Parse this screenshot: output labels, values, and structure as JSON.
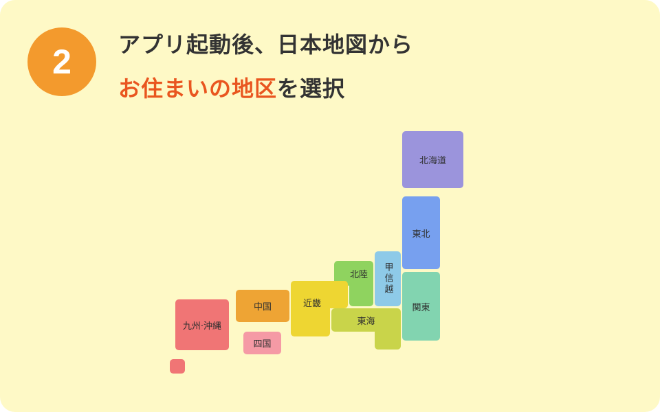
{
  "step": {
    "number": "2"
  },
  "title": {
    "line1": "アプリ起動後、日本地図から",
    "line2_highlight": "お住まいの地区",
    "line2_rest": "を選択"
  },
  "colors": {
    "card_bg": "#fef9c6",
    "badge": "#f39a2d",
    "highlight": "#e9561f",
    "text": "#333333"
  },
  "map": {
    "regions": [
      {
        "id": "hokkaido",
        "label": "北海道",
        "color": "#9b94dc"
      },
      {
        "id": "tohoku",
        "label": "東北",
        "color": "#77a0ef"
      },
      {
        "id": "kanto",
        "label": "関東",
        "color": "#82d4b0"
      },
      {
        "id": "koshinetsu",
        "label": "甲信越",
        "color": "#8ecae8"
      },
      {
        "id": "hokuriku",
        "label": "北陸",
        "color": "#8fd35f"
      },
      {
        "id": "tokai",
        "label": "東海",
        "color": "#c9d44a"
      },
      {
        "id": "kinki",
        "label": "近畿",
        "color": "#eed632"
      },
      {
        "id": "chugoku",
        "label": "中国",
        "color": "#eea434"
      },
      {
        "id": "shikoku",
        "label": "四国",
        "color": "#f59aa5"
      },
      {
        "id": "kyushu-okinawa",
        "label": "九州·沖縄",
        "color": "#f07575"
      }
    ]
  }
}
